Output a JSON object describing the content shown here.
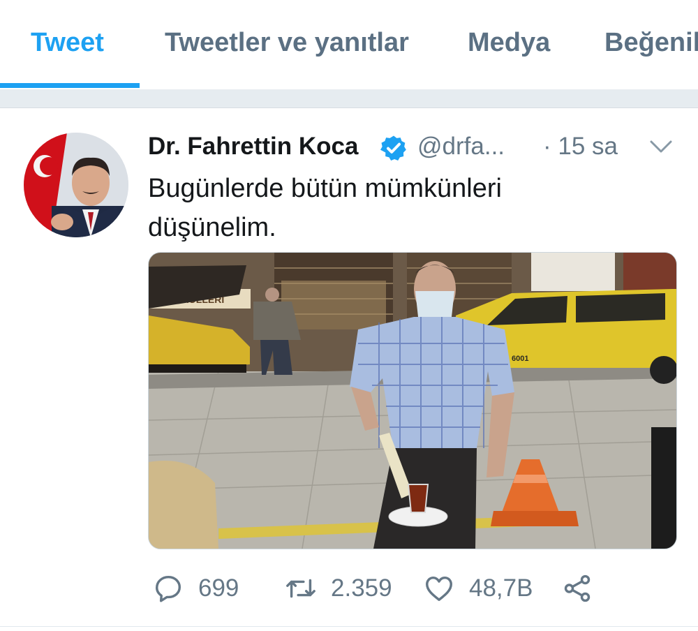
{
  "tabs": [
    {
      "label": "Tweet"
    },
    {
      "label": "Tweetler ve yanıtlar"
    },
    {
      "label": "Medya"
    },
    {
      "label": "Beğenil"
    }
  ],
  "tweet": {
    "author_name": "Dr. Fahrettin Koca",
    "handle": "@drfa...",
    "time": "· 15 sa",
    "text_line1": "Bugünlerde bütün mümkünleri",
    "text_line2": "düşünelim.",
    "media": {
      "shop_sign": "MÜLLERI",
      "taxi_number": "6001"
    }
  },
  "actions": {
    "reply_count": "699",
    "retweet_count": "2.359",
    "like_count": "48,7B"
  },
  "icons": {
    "verified": "verified-badge-icon",
    "caret": "chevron-down-icon",
    "reply": "reply-icon",
    "retweet": "retweet-icon",
    "like": "heart-icon",
    "share": "share-icon"
  },
  "colors": {
    "accent": "#1da1f2",
    "secondary_text": "#657786",
    "primary_text": "#14171a"
  }
}
